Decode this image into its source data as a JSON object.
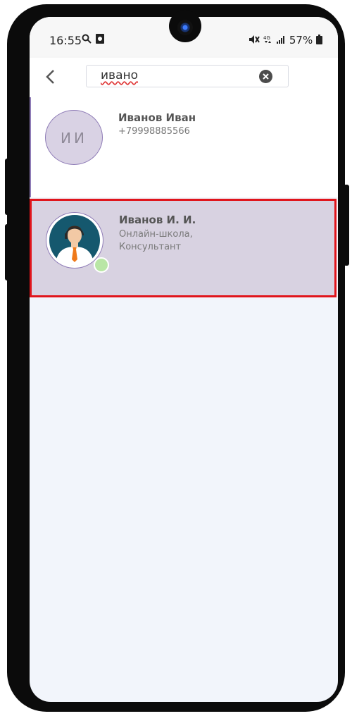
{
  "status_bar": {
    "time": "16:55",
    "battery": "57%"
  },
  "search": {
    "query": "ивано"
  },
  "contacts": [
    {
      "initials": "ИИ",
      "name": "Иванов Иван",
      "phone": "+79998885566"
    },
    {
      "name": "Иванов И. И.",
      "line1": "Онлайн-школа,",
      "line2": "Консультант",
      "online": true
    }
  ],
  "colors": {
    "selected_bg": "#d8d2e1",
    "highlight_border": "#e0141b",
    "avatar_border": "#8e7bb6",
    "online_dot": "#b9e6a6"
  },
  "icons": {
    "back": "chevron-left-icon",
    "clear": "clear-search-icon",
    "status_search": "search-icon",
    "status_app": "app-icon",
    "status_mute": "mute-icon",
    "status_network": "network-4g-icon",
    "status_signal": "signal-icon",
    "status_battery": "battery-icon"
  }
}
